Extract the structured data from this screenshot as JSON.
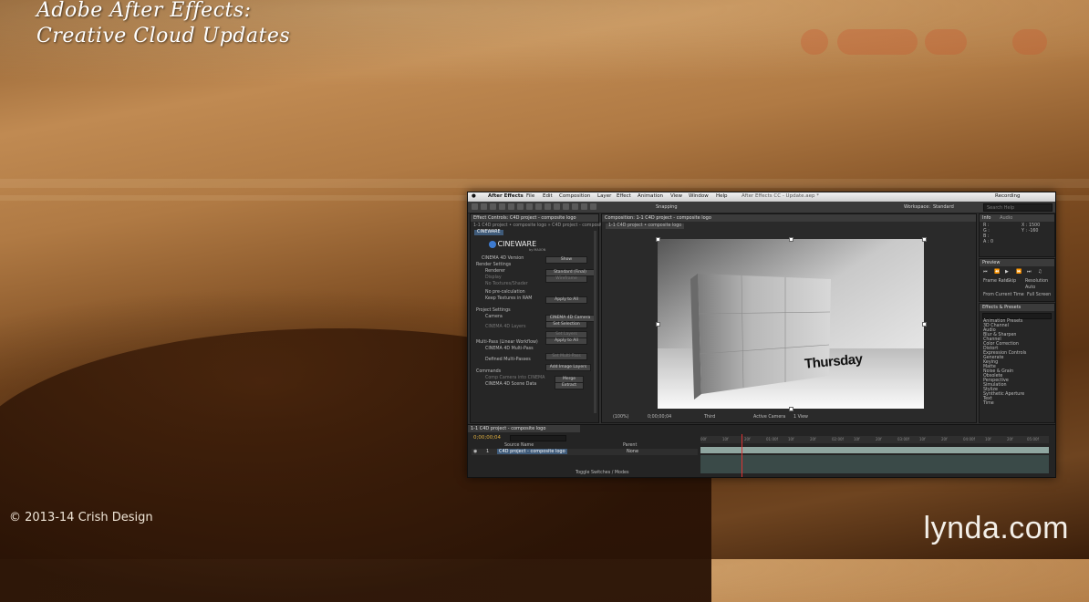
{
  "overlay": {
    "title_line1": "Adobe After Effects:",
    "title_line2": "Creative Cloud Updates",
    "copyright": "© 2013-14 Crish Design",
    "brand": "lynda.com"
  },
  "menubar": {
    "items": [
      "After Effects",
      "File",
      "Edit",
      "Composition",
      "Layer",
      "Effect",
      "Animation",
      "View",
      "Window",
      "Help"
    ],
    "window_title": "After Effects CC - Update.aep *",
    "recording": "Recording"
  },
  "toolbar": {
    "snapping": "Snapping",
    "workspace_label": "Workspace:",
    "workspace_value": "Standard",
    "search_placeholder": "Search Help"
  },
  "effect_controls": {
    "tab": "Effect Controls: C4D project - composite logo",
    "breadcrumb": "1-1 C4D project • composite logo » C4D project - composite logo",
    "layer": "CINEWARE",
    "plugin_name": "CINEWARE",
    "plugin_vendor": "by MAXON",
    "rows": [
      "CINEMA 4D Version",
      "Render Settings",
      "Renderer",
      "Display",
      "No Textures/Shader",
      "No pre-calculation",
      "Keep Textures in RAM",
      "Project Settings",
      "Camera",
      "CINEMA 4D Layers",
      "Multi-Pass (Linear Workflow)",
      "CINEMA 4D Multi-Pass",
      "Defined Multi-Passes",
      "Commands",
      "Comp Camera into CINEMA",
      "CINEMA 4D Scene Data"
    ],
    "buttons": [
      "Show",
      "Standard (Final)",
      "Wireframe",
      "Apply to All",
      "CINEMA 4D Camera",
      "Set Selection",
      "Set Layers",
      "Apply to All",
      "Set Multi-Pass",
      "Add Image Layers",
      "Merge",
      "Extract"
    ]
  },
  "composition": {
    "tab": "Composition: 1-1 C4D project - composite logo",
    "subtab": "1-1 C4D project • composite logo",
    "viewer_text": "Thursday",
    "footer": [
      "(100%)",
      "0;00;00;04",
      "Third",
      "Active Camera",
      "1 View"
    ]
  },
  "right_panels": {
    "info_tab": "Info",
    "audio_tab": "Audio",
    "info_lines": [
      "R :",
      "G :",
      "B :",
      "A : 0",
      "X : 1500",
      "Y : -160"
    ],
    "preview_tab": "Preview",
    "preview_labels": [
      "Frame Rate",
      "Skip",
      "Resolution",
      "Auto",
      "From Current Time",
      "Full Screen"
    ],
    "effects_tab": "Effects & Presets",
    "effects_list": [
      "Animation Presets",
      "3D Channel",
      "Audio",
      "Blur & Sharpen",
      "Channel",
      "Color Correction",
      "Distort",
      "Expression Controls",
      "Generate",
      "Keying",
      "Matte",
      "Noise & Grain",
      "Obsolete",
      "Perspective",
      "Simulation",
      "Stylize",
      "Synthetic Aperture",
      "Text",
      "Time"
    ]
  },
  "timeline": {
    "tab": "1-1 C4D project - composite logo",
    "timecode": "0;00;00;04",
    "layer_name": "C4D project - composite logo",
    "columns": [
      "Source Name",
      "Parent"
    ],
    "parent_value": "None",
    "footer": "Toggle Switches / Modes",
    "ruler": [
      "00f",
      "10f",
      "20f",
      "01:00f",
      "10f",
      "20f",
      "02:00f",
      "10f",
      "20f",
      "03:00f",
      "10f",
      "20f",
      "04:00f",
      "10f",
      "20f",
      "05:00f"
    ]
  },
  "colors": {
    "accent_timecode": "#e0b040",
    "playhead": "#dd3333",
    "track": "#8fa6a0"
  }
}
